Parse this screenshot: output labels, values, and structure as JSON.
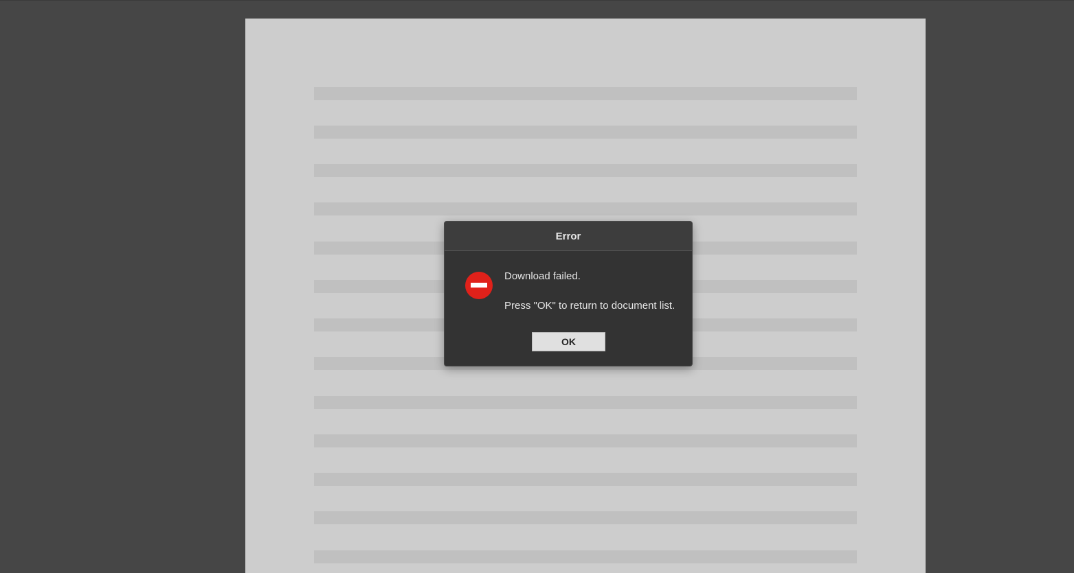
{
  "dialog": {
    "title": "Error",
    "icon": "error-stop-icon",
    "message": "Download failed.",
    "detail": "Press \"OK\" to return to document list.",
    "ok_label": "OK"
  },
  "colors": {
    "background": "#464646",
    "page": "#cdcdcd",
    "placeholder_line": "#c0c0c0",
    "dialog_bg": "#333333",
    "dialog_header_bg": "#3d3d3d",
    "error_red": "#e0211a",
    "button_bg": "#e0e0e0"
  }
}
